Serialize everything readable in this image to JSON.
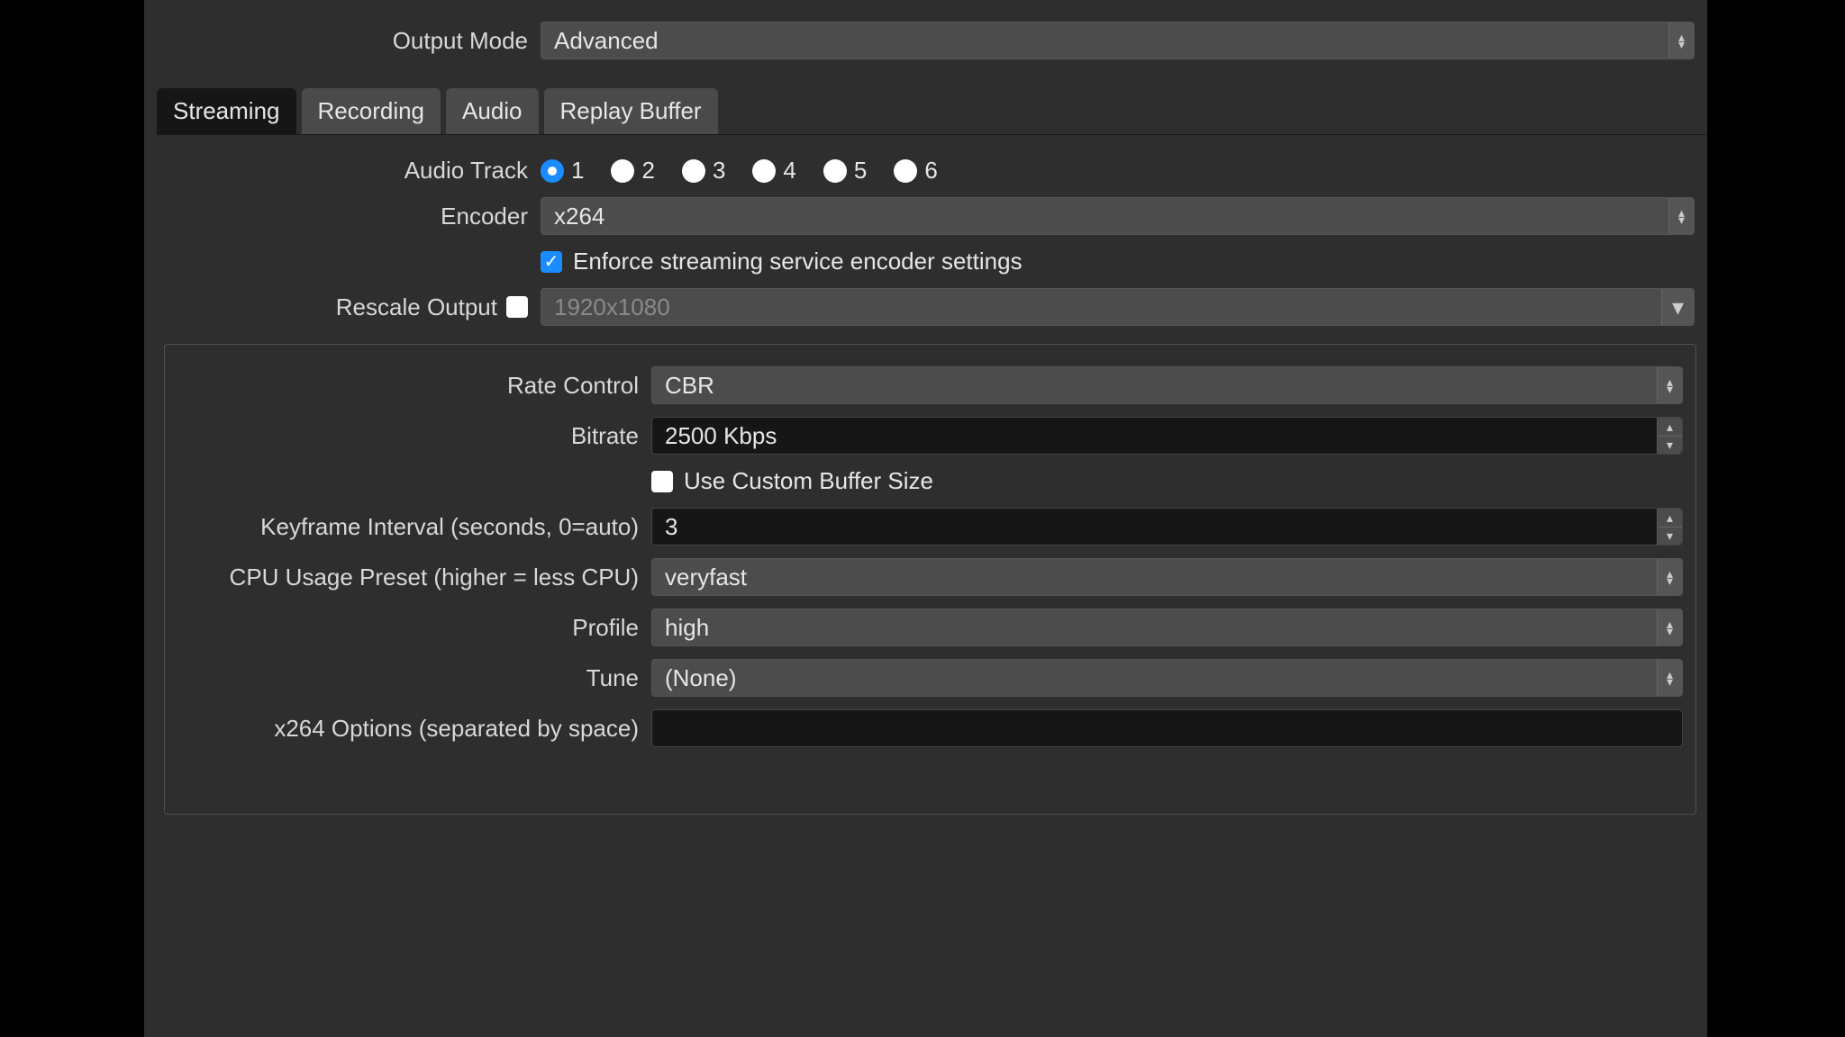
{
  "output_mode": {
    "label": "Output Mode",
    "value": "Advanced"
  },
  "tabs": [
    "Streaming",
    "Recording",
    "Audio",
    "Replay Buffer"
  ],
  "active_tab": "Streaming",
  "audio_track": {
    "label": "Audio Track",
    "options": [
      "1",
      "2",
      "3",
      "4",
      "5",
      "6"
    ],
    "selected": "1"
  },
  "encoder": {
    "label": "Encoder",
    "value": "x264"
  },
  "enforce": {
    "label": "Enforce streaming service encoder settings",
    "checked": true
  },
  "rescale": {
    "label": "Rescale Output",
    "checked": false,
    "value": "1920x1080"
  },
  "rate_control": {
    "label": "Rate Control",
    "value": "CBR"
  },
  "bitrate": {
    "label": "Bitrate",
    "value": "2500 Kbps"
  },
  "custom_buffer": {
    "label": "Use Custom Buffer Size",
    "checked": false
  },
  "keyframe": {
    "label": "Keyframe Interval (seconds, 0=auto)",
    "value": "3"
  },
  "cpu_preset": {
    "label": "CPU Usage Preset (higher = less CPU)",
    "value": "veryfast"
  },
  "profile": {
    "label": "Profile",
    "value": "high"
  },
  "tune": {
    "label": "Tune",
    "value": "(None)"
  },
  "x264_opts": {
    "label": "x264 Options (separated by space)",
    "value": ""
  }
}
